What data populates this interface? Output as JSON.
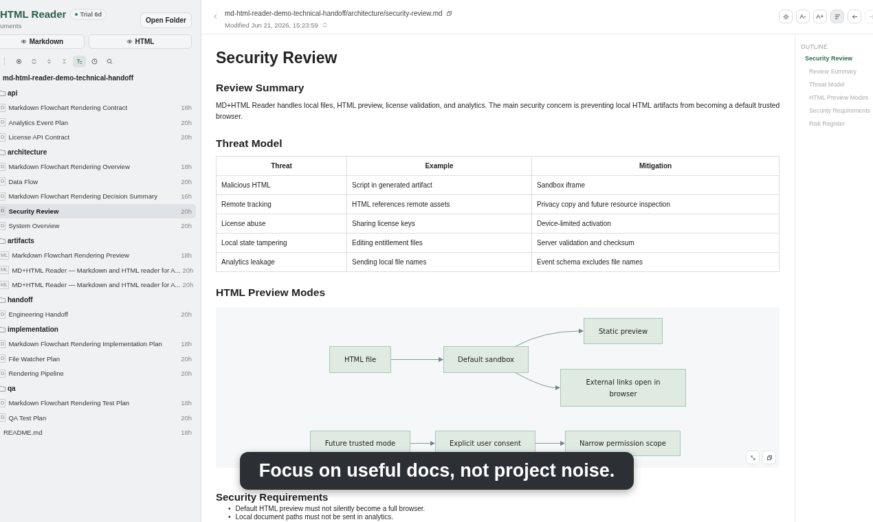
{
  "sidebar": {
    "app_title": "HTML Reader",
    "trial_badge": "Trial 6d",
    "subtitle": "uments",
    "open_button": "Open Folder",
    "mode_buttons": [
      "Markdown",
      "HTML"
    ],
    "toolbar": [
      {
        "kind": "locate",
        "selected": false
      },
      {
        "kind": "refresh",
        "selected": false
      },
      {
        "kind": "expand",
        "selected": false
      },
      {
        "kind": "collapse",
        "selected": false
      },
      {
        "kind": "titles",
        "selected": true
      },
      {
        "kind": "recent",
        "selected": false
      },
      {
        "kind": "search",
        "selected": false
      }
    ],
    "tree": {
      "name": "md-html-reader-demo-technical-handoff",
      "children": [
        {
          "kind": "folder",
          "name": "api",
          "children": [
            {
              "kind": "file",
              "badge": "D",
              "name": "Markdown Flowchart Rendering Contract",
              "age": "18h",
              "selected": false
            },
            {
              "kind": "file",
              "badge": "D",
              "name": "Analytics Event Plan",
              "age": "20h",
              "selected": false
            },
            {
              "kind": "file",
              "badge": "D",
              "name": "License API Contract",
              "age": "20h",
              "selected": false
            }
          ]
        },
        {
          "kind": "folder",
          "name": "architecture",
          "children": [
            {
              "kind": "file",
              "badge": "D",
              "name": "Markdown Flowchart Rendering Overview",
              "age": "18h",
              "selected": false
            },
            {
              "kind": "file",
              "badge": "D",
              "name": "Data Flow",
              "age": "20h",
              "selected": false
            },
            {
              "kind": "file",
              "badge": "D",
              "name": "Markdown Flowchart Rendering Decision Summary",
              "age": "16h",
              "selected": false
            },
            {
              "kind": "file",
              "badge": "D",
              "name": "Security Review",
              "age": "20h",
              "selected": true
            },
            {
              "kind": "file",
              "badge": "D",
              "name": "System Overview",
              "age": "20h",
              "selected": false
            }
          ]
        },
        {
          "kind": "folder",
          "name": "artifacts",
          "children": [
            {
              "kind": "file",
              "badge": "ML",
              "name": "Markdown Flowchart Rendering Preview",
              "age": "18h",
              "selected": false
            },
            {
              "kind": "file",
              "badge": "ML",
              "name": "MD+HTML Reader — Markdown and HTML reader for A...",
              "age": "20h",
              "selected": false
            },
            {
              "kind": "file",
              "badge": "ML",
              "name": "MD+HTML Reader — Markdown and HTML reader for A...",
              "age": "20h",
              "selected": false
            }
          ]
        },
        {
          "kind": "folder",
          "name": "handoff",
          "children": [
            {
              "kind": "file",
              "badge": "D",
              "name": "Engineering Handoff",
              "age": "20h",
              "selected": false
            }
          ]
        },
        {
          "kind": "folder",
          "name": "implementation",
          "children": [
            {
              "kind": "file",
              "badge": "D",
              "name": "Markdown Flowchart Rendering Implementation Plan",
              "age": "18h",
              "selected": false
            },
            {
              "kind": "file",
              "badge": "D",
              "name": "File Watcher Plan",
              "age": "20h",
              "selected": false
            },
            {
              "kind": "file",
              "badge": "D",
              "name": "Rendering Pipeline",
              "age": "20h",
              "selected": false
            }
          ]
        },
        {
          "kind": "folder",
          "name": "qa",
          "children": [
            {
              "kind": "file",
              "badge": "D",
              "name": "Markdown Flowchart Rendering Test Plan",
              "age": "18h",
              "selected": false
            },
            {
              "kind": "file",
              "badge": "D",
              "name": "QA Test Plan",
              "age": "20h",
              "selected": false
            }
          ]
        },
        {
          "kind": "file",
          "name": "README.md",
          "age": "18h",
          "selected": false
        }
      ]
    }
  },
  "header": {
    "path": "md-html-reader-demo-technical-handoff/architecture/security-review.md",
    "modified": "Modified Jun 21, 2026, 15:23:59",
    "buttons": [
      {
        "kind": "theme",
        "selected": false,
        "disabled": false
      },
      {
        "kind": "text",
        "label": "A-",
        "selected": false,
        "disabled": false
      },
      {
        "kind": "text",
        "label": "A+",
        "selected": false,
        "disabled": false
      },
      {
        "kind": "outline",
        "selected": true,
        "disabled": false
      },
      {
        "kind": "back",
        "selected": false,
        "disabled": false
      },
      {
        "kind": "forward",
        "selected": false,
        "disabled": true
      }
    ]
  },
  "document": {
    "title": "Security Review",
    "sections": [
      {
        "heading": "Review Summary",
        "kind": "paragraph",
        "text": "MD+HTML Reader handles local files, HTML preview, license validation, and analytics. The main security concern is preventing local HTML artifacts from becoming a default trusted browser."
      },
      {
        "heading": "Threat Model",
        "kind": "table",
        "columns": [
          "Threat",
          "Example",
          "Mitigation"
        ],
        "rows": [
          [
            "Malicious HTML",
            "Script in generated artifact",
            "Sandbox iframe"
          ],
          [
            "Remote tracking",
            "HTML references remote assets",
            "Privacy copy and future resource inspection"
          ],
          [
            "License abuse",
            "Sharing license keys",
            "Device-limited activation"
          ],
          [
            "Local state tampering",
            "Editing entitlement files",
            "Server validation and checksum"
          ],
          [
            "Analytics leakage",
            "Sending local file names",
            "Event schema excludes file names"
          ]
        ]
      },
      {
        "heading": "HTML Preview Modes",
        "kind": "diagram",
        "nodes": [
          "HTML file",
          "Default sandbox",
          "Static preview",
          "External links open in browser",
          "Future trusted mode",
          "Explicit user consent",
          "Narrow permission scope"
        ]
      },
      {
        "heading": "Security Requirements",
        "kind": "list",
        "marker": "•",
        "items": [
          "Default HTML preview must not silently become a full browser.",
          "Local document paths must not be sent in analytics."
        ]
      }
    ]
  },
  "outline": {
    "title": "OUTLINE",
    "items": [
      {
        "label": "Security Review",
        "selected": true,
        "children": [
          {
            "label": "Review Summary",
            "selected": false
          },
          {
            "label": "Threat Model",
            "selected": false
          },
          {
            "label": "HTML Preview Modes",
            "selected": false
          },
          {
            "label": "Security Requirements",
            "selected": false
          },
          {
            "label": "Risk Register",
            "selected": false
          }
        ]
      }
    ]
  },
  "caption": "Focus on useful docs, not project noise."
}
